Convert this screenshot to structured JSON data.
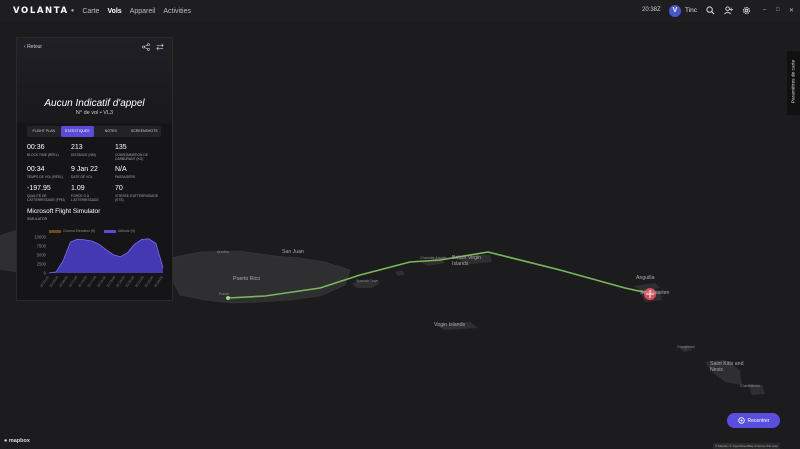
{
  "app": {
    "logo": "VOLANTA",
    "logo_mark": "●"
  },
  "nav": [
    "Carte",
    "Vols",
    "Appareil",
    "Activities"
  ],
  "nav_active_index": 1,
  "topbar": {
    "clock": "20:38Z",
    "avatar_initial": "V",
    "username": "Tinc"
  },
  "panel": {
    "back_label": "Retour",
    "callsign": "Aucun Indicatif d'appel",
    "subtitle": "N° de vol • VL3",
    "tabs": [
      "FLIGHT PLAN",
      "STATISTIQUES",
      "NOTES",
      "SCREENSHOTS"
    ],
    "active_tab_index": 1,
    "stats": [
      {
        "value": "00:36",
        "label": "BLOCK TIME (RÉEL)"
      },
      {
        "value": "213",
        "label": "DISTANCE (NM)"
      },
      {
        "value": "135",
        "label": "CONSOMMATION DE CARBURANT (KG)"
      },
      {
        "value": "00:34",
        "label": "TEMPS DE VOL (RÉEL)"
      },
      {
        "value": "9 Jan 22",
        "label": "DATE DE VOL"
      },
      {
        "value": "N/A",
        "label": "PASSAGERS"
      },
      {
        "value": "-197.95",
        "label": "QUALITÉ DE L'ATTERRISSAGE (FPM)"
      },
      {
        "value": "1.09",
        "label": "FORCE G À L'ATTERRISSAGE"
      },
      {
        "value": "70",
        "label": "VITESSE D'ATTERRISSAGE (KTS)"
      }
    ],
    "simulator_name": "Microsoft Flight Simulator",
    "simulator_label": "SIMULATOR",
    "legend": [
      {
        "name": "Ground Elevation (ft)",
        "color": "#8a5a2a"
      },
      {
        "name": "Altitude (ft)",
        "color": "#5b4bd6"
      }
    ]
  },
  "chart_data": {
    "type": "area",
    "series": [
      {
        "name": "Altitude (ft)",
        "values": [
          0,
          300,
          3500,
          8600,
          9400,
          9200,
          8900,
          8000,
          6500,
          5100,
          4500,
          5600,
          8000,
          9300,
          9500,
          8200,
          1500
        ]
      },
      {
        "name": "Ground Elevation (ft)",
        "values": [
          0,
          0,
          0,
          0,
          0,
          0,
          0,
          0,
          0,
          0,
          0,
          0,
          0,
          0,
          0,
          0,
          0
        ]
      }
    ],
    "y_ticks": [
      "10000",
      "7500",
      "5000",
      "2500",
      "0"
    ],
    "ylim": [
      0,
      10000
    ],
    "x_tick_labels": [
      "20:02:00",
      "20:05:00",
      "20:08:00",
      "20:11:00",
      "20:14:00",
      "20:17:00",
      "20:20:00",
      "20:23:00",
      "20:26:00",
      "20:29:00",
      "20:32:00",
      "20:35:00",
      "20:38:00"
    ]
  },
  "map": {
    "places": [
      {
        "name": "San Juan",
        "cls": ""
      },
      {
        "name": "Arecibo",
        "cls": "small"
      },
      {
        "name": "Puerto Rico",
        "cls": ""
      },
      {
        "name": "Ponce",
        "cls": "small"
      },
      {
        "name": "Charlotte Amalie",
        "cls": "small"
      },
      {
        "name": "British Virgin Islands",
        "cls": ""
      },
      {
        "name": "Spanish Town",
        "cls": "small"
      },
      {
        "name": "Virgin Islands",
        "cls": ""
      },
      {
        "name": "Anguilla",
        "cls": ""
      },
      {
        "name": "Sint Maarten",
        "cls": ""
      },
      {
        "name": "Oranjestad",
        "cls": "small"
      },
      {
        "name": "Saint Kitts and Nevis",
        "cls": ""
      },
      {
        "name": "Charlestown",
        "cls": "small"
      }
    ],
    "recenter_label": "Recentrer",
    "settings_label": "Paramètres de carte",
    "mapbox_label": "mapbox",
    "attribution": "© Mapbox © OpenStreetMap Improve this map"
  }
}
